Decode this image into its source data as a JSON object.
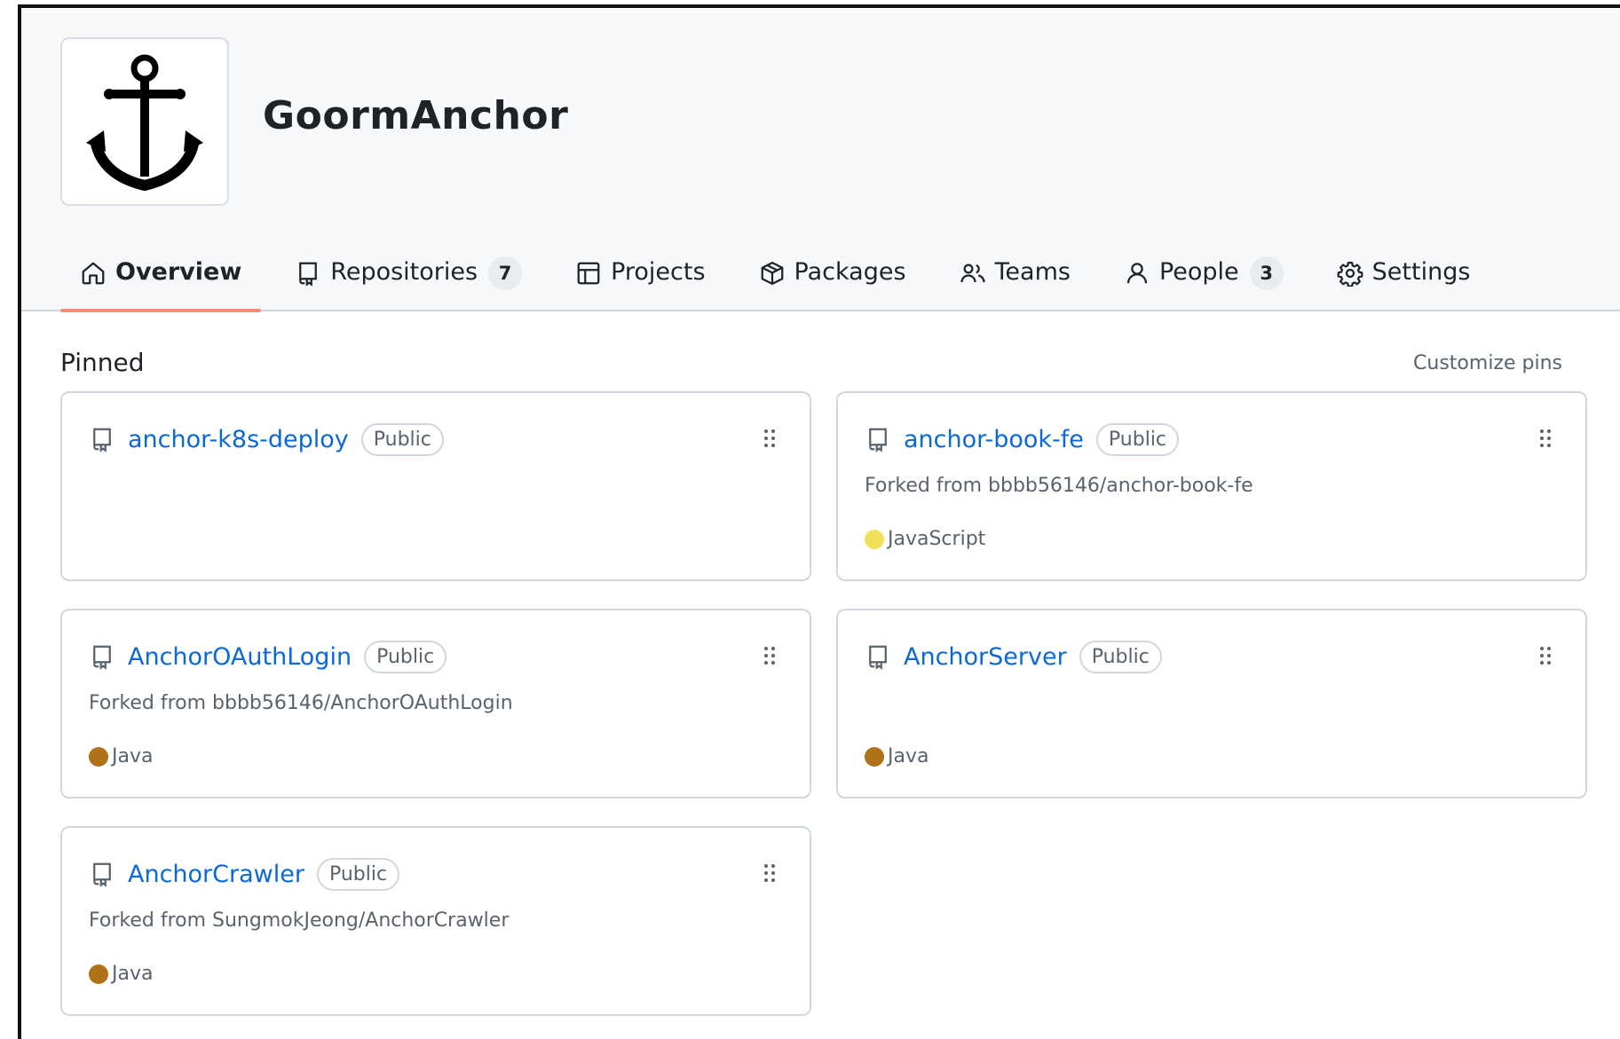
{
  "org": {
    "name": "GoormAnchor",
    "avatar_icon": "anchor-icon"
  },
  "tabs": [
    {
      "label": "Overview",
      "icon": "home-icon",
      "active": true
    },
    {
      "label": "Repositories",
      "icon": "repo-icon",
      "count": "7"
    },
    {
      "label": "Projects",
      "icon": "table-icon"
    },
    {
      "label": "Packages",
      "icon": "package-icon"
    },
    {
      "label": "Teams",
      "icon": "people-icon"
    },
    {
      "label": "People",
      "icon": "person-icon",
      "count": "3"
    },
    {
      "label": "Settings",
      "icon": "gear-icon"
    }
  ],
  "pinned": {
    "title": "Pinned",
    "customize_label": "Customize pins",
    "repos": [
      {
        "name": "anchor-k8s-deploy",
        "visibility": "Public",
        "fork": "",
        "language": "",
        "language_color": ""
      },
      {
        "name": "anchor-book-fe",
        "visibility": "Public",
        "fork": "Forked from bbbb56146/anchor-book-fe",
        "language": "JavaScript",
        "language_color": "#f1e05a"
      },
      {
        "name": "AnchorOAuthLogin",
        "visibility": "Public",
        "fork": "Forked from bbbb56146/AnchorOAuthLogin",
        "language": "Java",
        "language_color": "#b07219"
      },
      {
        "name": "AnchorServer",
        "visibility": "Public",
        "fork": "",
        "language": "Java",
        "language_color": "#b07219"
      },
      {
        "name": "AnchorCrawler",
        "visibility": "Public",
        "fork": "Forked from SungmokJeong/AnchorCrawler",
        "language": "Java",
        "language_color": "#b07219"
      }
    ]
  },
  "colors": {
    "accent": "#fd8c73",
    "link": "#0969da",
    "header_bg": "#f6f8fa"
  }
}
